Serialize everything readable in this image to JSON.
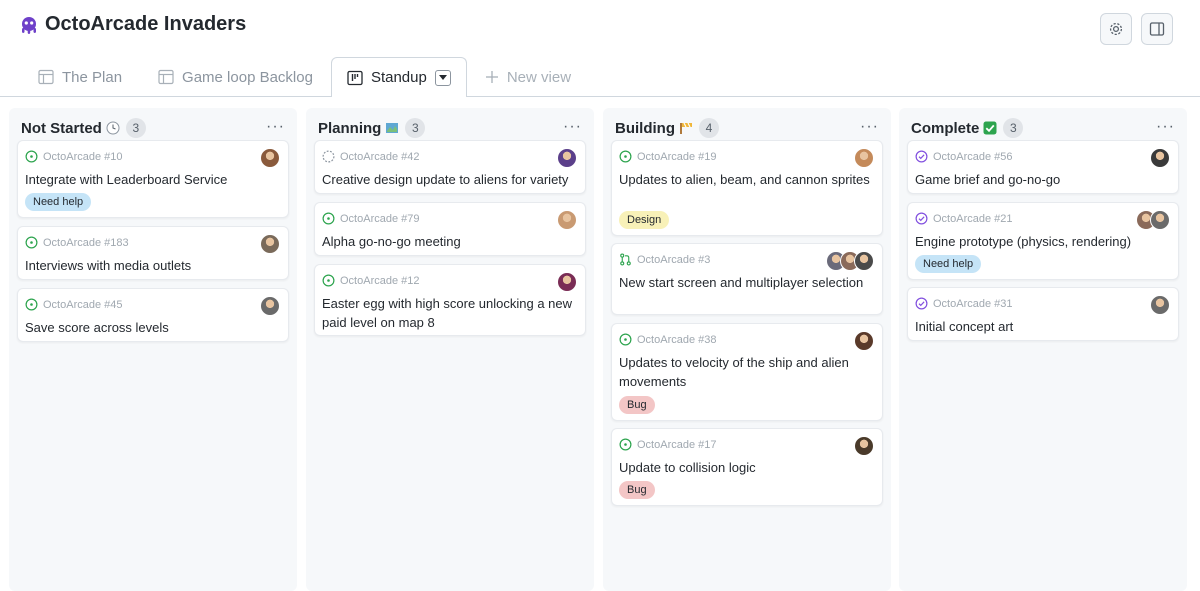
{
  "app": {
    "title": "OctoArcade Invaders"
  },
  "tabs": [
    {
      "label": "The Plan",
      "icon": "table-icon",
      "active": false
    },
    {
      "label": "Game loop Backlog",
      "icon": "table-icon",
      "active": false
    },
    {
      "label": "Standup",
      "icon": "board-icon",
      "active": true
    },
    {
      "label": "New view",
      "icon": "plus-icon",
      "active": false
    }
  ],
  "colors": {
    "open": "#2da44e",
    "draft": "#8c959f",
    "done": "#8250df",
    "need_help": "#c5e4f7",
    "design": "#f8f1b8",
    "bug": "#f3c6c6"
  },
  "columns": [
    {
      "title": "Not Started",
      "emoji": "clock",
      "count": "3",
      "cards": [
        {
          "ref": "OctoArcade #10",
          "state": "open",
          "title": "Integrate with Leaderboard Service",
          "label": "Need help",
          "avatars": [
            "#8a5a3c"
          ]
        },
        {
          "ref": "OctoArcade #183",
          "state": "open",
          "title": "Interviews with media outlets",
          "label": "",
          "avatars": [
            "#7a6a5a"
          ]
        },
        {
          "ref": "OctoArcade #45",
          "state": "open",
          "title": "Save score across levels",
          "label": "",
          "avatars": [
            "#6a6a6a"
          ]
        }
      ]
    },
    {
      "title": "Planning",
      "emoji": "map",
      "count": "3",
      "cards": [
        {
          "ref": "OctoArcade #42",
          "state": "draft",
          "title": "Creative design update to aliens for variety",
          "label": "",
          "avatars": [
            "#5b3f8a"
          ]
        },
        {
          "ref": "OctoArcade #79",
          "state": "open",
          "title": "Alpha go-no-go meeting",
          "label": "",
          "avatars": [
            "#c99a72"
          ]
        },
        {
          "ref": "OctoArcade #12",
          "state": "open",
          "title": "Easter egg with high score unlocking a new paid level on map 8",
          "label": "",
          "avatars": [
            "#7a2c55"
          ]
        }
      ]
    },
    {
      "title": "Building",
      "emoji": "construction",
      "count": "4",
      "cards": [
        {
          "ref": "OctoArcade #19",
          "state": "open",
          "title": "Updates to alien, beam, and cannon sprites",
          "label": "Design",
          "avatars": [
            "#c48a5a"
          ]
        },
        {
          "ref": "OctoArcade #3",
          "state": "pr",
          "title": "New start screen and multiplayer selection",
          "label": "",
          "avatars": [
            "#6a6a7a",
            "#8a6a5a",
            "#4a4a4a"
          ]
        },
        {
          "ref": "OctoArcade #38",
          "state": "open",
          "title": "Updates to velocity of the ship and alien movements",
          "label": "Bug",
          "avatars": [
            "#5a3a2a"
          ]
        },
        {
          "ref": "OctoArcade #17",
          "state": "open",
          "title": "Update to collision logic",
          "label": "Bug",
          "avatars": [
            "#4a3a2a"
          ]
        }
      ]
    },
    {
      "title": "Complete",
      "emoji": "check",
      "count": "3",
      "cards": [
        {
          "ref": "OctoArcade #56",
          "state": "done",
          "title": "Game brief and go-no-go",
          "label": "",
          "avatars": [
            "#3a3a3a"
          ]
        },
        {
          "ref": "OctoArcade #21",
          "state": "done",
          "title": "Engine prototype (physics, rendering)",
          "label": "Need help",
          "avatars": [
            "#8a6a5a",
            "#6a6a6a"
          ]
        },
        {
          "ref": "OctoArcade #31",
          "state": "done",
          "title": "Initial concept art",
          "label": "",
          "avatars": [
            "#6a6a6a"
          ]
        }
      ]
    }
  ]
}
